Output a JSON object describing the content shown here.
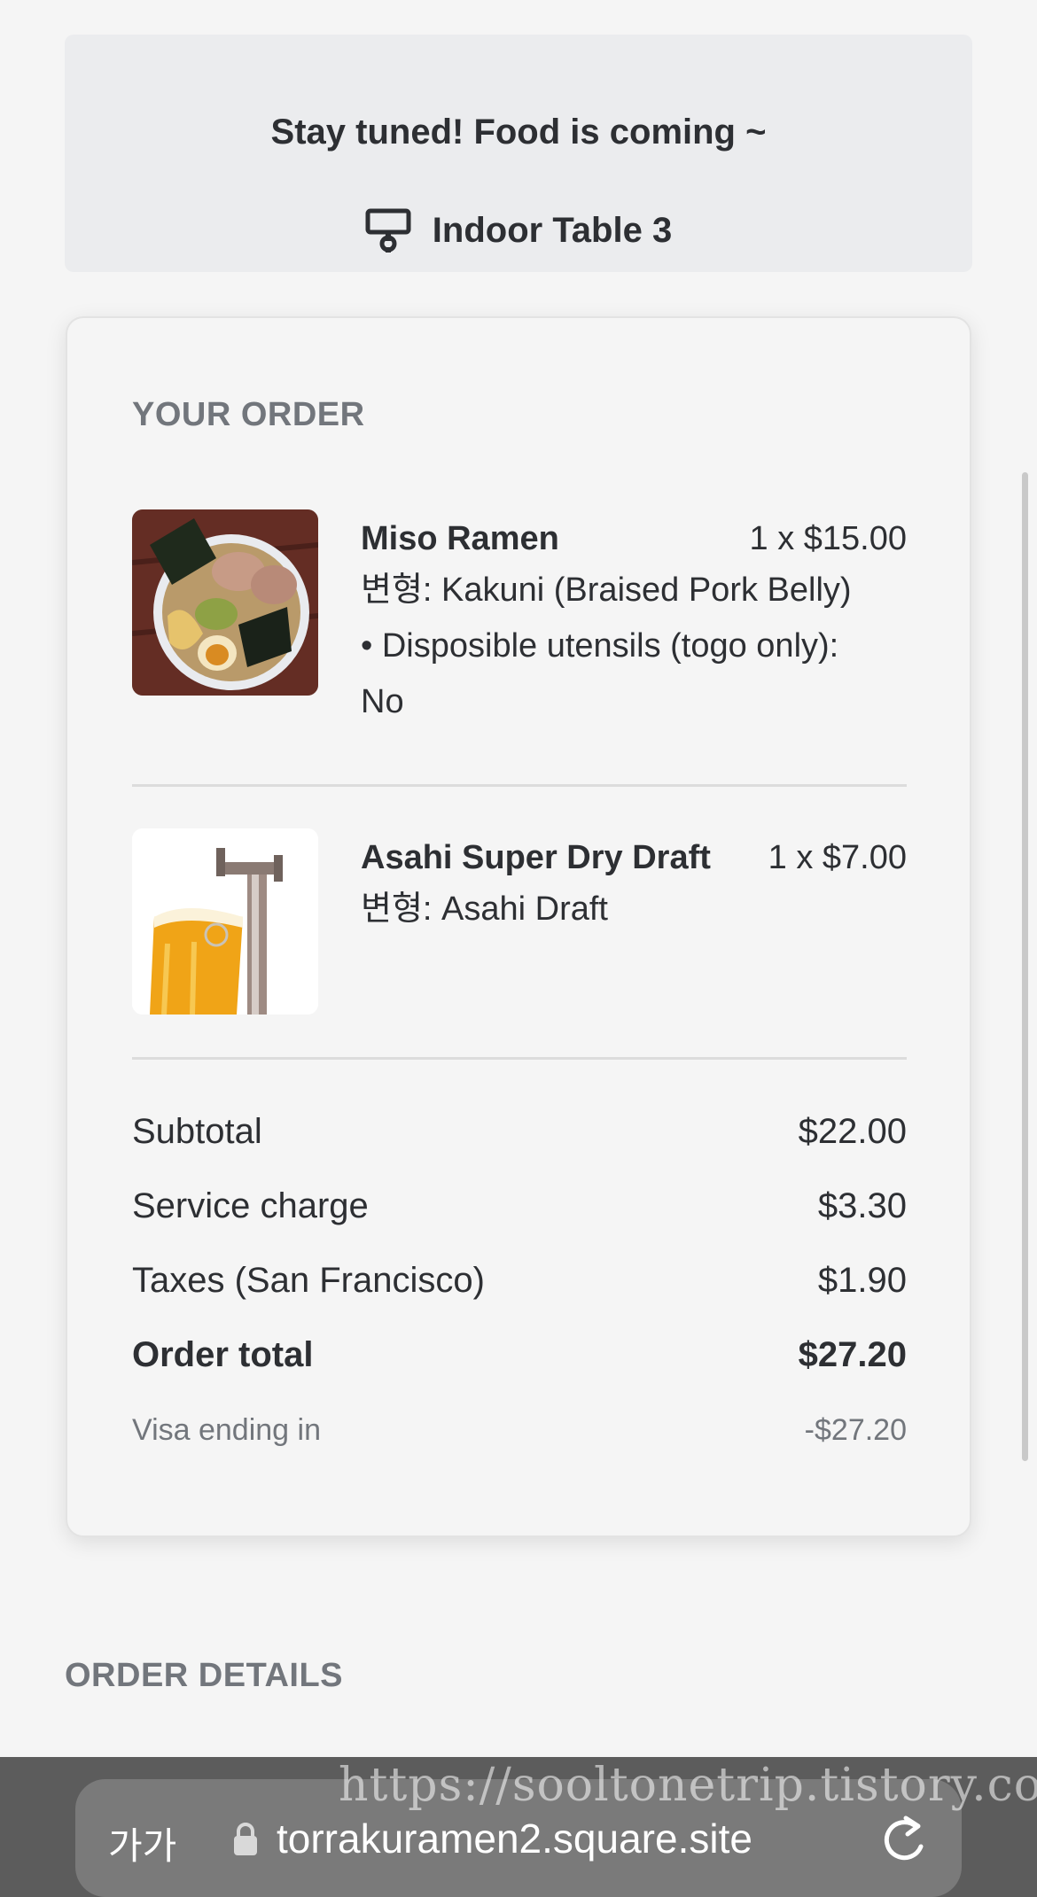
{
  "banner": {
    "title": "Stay tuned! Food is coming ~",
    "table_label": "Indoor Table 3",
    "table_icon": "table-stand-icon"
  },
  "order": {
    "heading": "YOUR ORDER",
    "items": [
      {
        "name": "Miso Ramen",
        "price": "1 x $15.00",
        "description": "변형: Kakuni (Braised Pork Belly) • Disposible utensils (togo only): No"
      },
      {
        "name": "Asahi Super Dry Draft",
        "price": "1 x $7.00",
        "description": "변형: Asahi Draft"
      }
    ],
    "summary": {
      "subtotal_label": "Subtotal",
      "subtotal_value": "$22.00",
      "service_label": "Service charge",
      "service_value": "$3.30",
      "taxes_label": "Taxes (San Francisco)",
      "taxes_value": "$1.90",
      "total_label": "Order total",
      "total_value": "$27.20",
      "payment_label": "Visa ending in",
      "payment_value": "-$27.20"
    }
  },
  "details": {
    "heading": "ORDER DETAILS"
  },
  "browser": {
    "text_size_label": "가가",
    "url": "torrakuramen2.square.site",
    "lock_icon": "lock-icon",
    "reload_icon": "reload-icon"
  },
  "watermark": "https://sooltonetrip.tistory.com"
}
